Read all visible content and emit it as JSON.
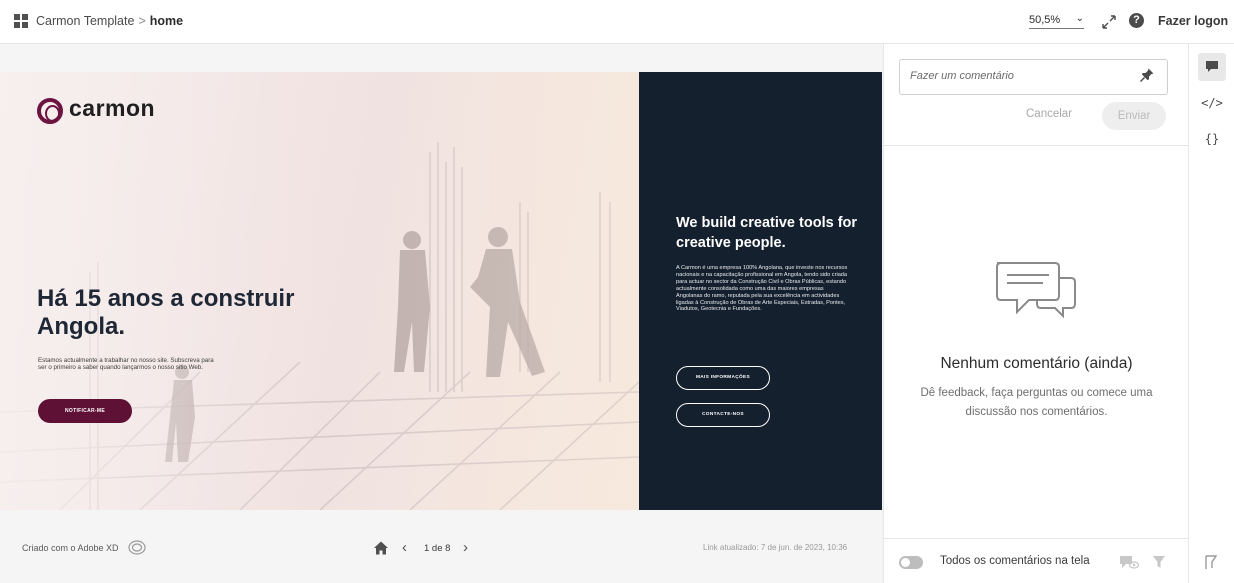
{
  "topbar": {
    "project": "Carmon Template",
    "separator": ">",
    "page": "home",
    "zoom": "50,5%",
    "login": "Fazer logon"
  },
  "artboard": {
    "logo_text": "carmon",
    "hero_title": "Há 15 anos a construir Angola.",
    "hero_sub": "Estamos actualmente a trabalhar no nosso site. Subscreva para ser o primeiro a saber quando lançarmos o nosso sitio Web.",
    "notify_button": "NOTIFICAR-ME",
    "dark_title": "We build creative tools for creative people.",
    "dark_body": "A Carmon é uma empresa 100% Angolana, que investe nos recursos nacionais e na capacitação profissional em Angola, tendo sido criada para actuar no sector da Construção Civil e Obras Públicas, estando actualmente consolidada como uma das maiores empresas Angolanas do ramo, reputada pela sua excelência em actividades ligadas à Construção de Obras de Arte Especiais, Estradas, Pontes, Viadutos, Geotecnia e Fundações.",
    "more_info_button": "MAIS INFORMAÇÕES",
    "contact_button": "CONTACTE-NOS"
  },
  "footer": {
    "credit": "Criado com o Adobe XD",
    "page_indicator": "1 de 8",
    "updated": "Link atualizado: 7 de jun. de 2023, 10:36"
  },
  "comments": {
    "placeholder": "Fazer um comentário",
    "cancel": "Cancelar",
    "send": "Enviar",
    "empty_title": "Nenhum comentário (ainda)",
    "empty_sub": "Dê feedback, faça perguntas ou comece uma discussão nos comentários.",
    "toggle_label": "Todos os comentários na tela"
  },
  "rail": {
    "code_label": "</>",
    "json_label": "{}"
  },
  "colors": {
    "brand": "#6d1340",
    "dark_panel": "#14202e"
  },
  "icons": [
    "grid-icon",
    "expand-icon",
    "help-icon",
    "cc-icon",
    "home-icon",
    "pin-icon",
    "comment-empty-icon",
    "hide-comments-icon",
    "filter-icon",
    "comment-icon",
    "flag-icon"
  ]
}
